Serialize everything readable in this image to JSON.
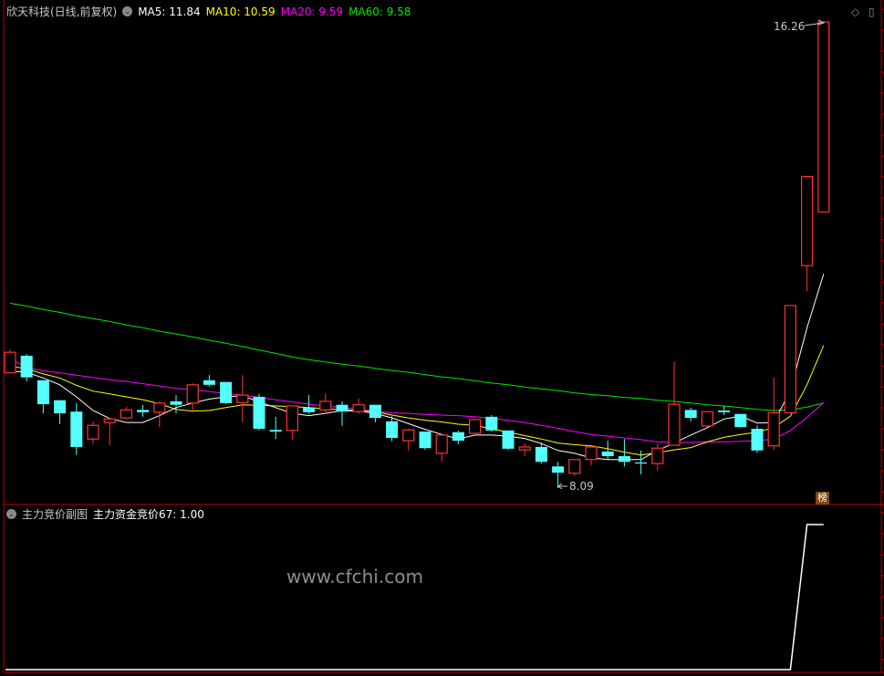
{
  "header": {
    "title": "欣天科技(日线,前复权)",
    "ma5": "MA5: 11.84",
    "ma10": "MA10: 10.59",
    "ma20": "MA20: 9.59",
    "ma60": "MA60: 9.58"
  },
  "sub_header": {
    "title": "主力竞价副图",
    "indicator": "主力资金竞价67: 1.00"
  },
  "badge": "榜",
  "watermark": "www.cfchi.com",
  "icons": [
    "chevron-down-icon",
    "diamond-icon",
    "panel-toggle-icon"
  ],
  "colors": {
    "up": "#ff3232",
    "down": "#54ffff",
    "ma5": "#ffffff",
    "ma10": "#ffff00",
    "ma20": "#ff00ff",
    "ma60": "#00e600",
    "divider": "#c00000"
  },
  "chart_data": [
    {
      "type": "candlestick",
      "high_label": "16.26",
      "low_label": "8.09",
      "ohlc": [
        [
          10.11,
          10.52,
          10.11,
          10.47
        ],
        [
          10.41,
          10.44,
          9.96,
          10.03
        ],
        [
          9.98,
          9.98,
          9.4,
          9.56
        ],
        [
          9.63,
          9.63,
          9.21,
          9.4
        ],
        [
          9.43,
          9.58,
          8.67,
          8.81
        ],
        [
          8.95,
          9.26,
          8.87,
          9.19
        ],
        [
          9.24,
          9.32,
          8.84,
          9.3
        ],
        [
          9.32,
          9.51,
          9.32,
          9.46
        ],
        [
          9.46,
          9.55,
          9.34,
          9.42
        ],
        [
          9.42,
          9.61,
          9.16,
          9.58
        ],
        [
          9.61,
          9.72,
          9.4,
          9.55
        ],
        [
          9.58,
          9.93,
          9.42,
          9.9
        ],
        [
          9.98,
          10.07,
          9.87,
          9.9
        ],
        [
          9.95,
          9.95,
          9.56,
          9.58
        ],
        [
          9.59,
          10.07,
          9.24,
          9.72
        ],
        [
          9.69,
          9.74,
          9.1,
          9.13
        ],
        [
          9.11,
          9.34,
          8.95,
          9.08
        ],
        [
          9.1,
          9.53,
          8.94,
          9.53
        ],
        [
          9.5,
          9.72,
          9.39,
          9.42
        ],
        [
          9.46,
          9.75,
          9.4,
          9.61
        ],
        [
          9.55,
          9.61,
          9.18,
          9.43
        ],
        [
          9.43,
          9.66,
          9.39,
          9.55
        ],
        [
          9.55,
          9.55,
          9.24,
          9.32
        ],
        [
          9.26,
          9.35,
          8.91,
          8.97
        ],
        [
          8.92,
          9.13,
          8.75,
          9.11
        ],
        [
          9.08,
          9.08,
          8.76,
          8.79
        ],
        [
          8.7,
          9.02,
          8.55,
          9.02
        ],
        [
          9.07,
          9.1,
          8.86,
          8.92
        ],
        [
          9.05,
          9.3,
          9.05,
          9.29
        ],
        [
          9.34,
          9.37,
          9.08,
          9.1
        ],
        [
          9.1,
          9.1,
          8.76,
          8.78
        ],
        [
          8.76,
          8.87,
          8.65,
          8.81
        ],
        [
          8.81,
          8.89,
          8.52,
          8.55
        ],
        [
          8.47,
          8.55,
          8.09,
          8.36
        ],
        [
          8.35,
          8.59,
          8.3,
          8.59
        ],
        [
          8.59,
          8.81,
          8.49,
          8.81
        ],
        [
          8.73,
          8.92,
          8.6,
          8.65
        ],
        [
          8.65,
          8.95,
          8.47,
          8.55
        ],
        [
          8.54,
          8.75,
          8.33,
          8.52
        ],
        [
          8.52,
          8.87,
          8.39,
          8.79
        ],
        [
          8.84,
          10.31,
          8.84,
          9.56
        ],
        [
          9.46,
          9.5,
          9.26,
          9.32
        ],
        [
          9.18,
          9.43,
          9.18,
          9.43
        ],
        [
          9.45,
          9.53,
          9.37,
          9.42
        ],
        [
          9.39,
          9.39,
          9.15,
          9.16
        ],
        [
          9.13,
          9.19,
          8.71,
          8.75
        ],
        [
          8.83,
          10.03,
          8.76,
          9.41
        ],
        [
          9.41,
          11.29,
          9.41,
          11.29
        ],
        [
          11.99,
          13.55,
          11.54,
          13.55
        ],
        [
          12.93,
          16.26,
          12.93,
          16.26
        ]
      ],
      "ma5": [
        10.14,
        10.12,
        10.02,
        9.9,
        9.69,
        9.45,
        9.31,
        9.24,
        9.24,
        9.36,
        9.5,
        9.58,
        9.65,
        9.69,
        9.71,
        9.6,
        9.5,
        9.4,
        9.36,
        9.4,
        9.45,
        9.44,
        9.4,
        9.32,
        9.22,
        9.12,
        9.03,
        8.95,
        9.02,
        9.02,
        9.0,
        8.96,
        8.87,
        8.75,
        8.7,
        8.62,
        8.59,
        8.59,
        8.59,
        8.75,
        8.88,
        9.02,
        9.15,
        9.3,
        9.35,
        9.23,
        9.24,
        9.8,
        10.9,
        11.84
      ],
      "ma10": [
        10.23,
        10.18,
        10.09,
        10.02,
        9.89,
        9.79,
        9.74,
        9.69,
        9.64,
        9.57,
        9.47,
        9.44,
        9.45,
        9.5,
        9.55,
        9.54,
        9.53,
        9.52,
        9.5,
        9.48,
        9.46,
        9.45,
        9.43,
        9.37,
        9.32,
        9.28,
        9.25,
        9.21,
        9.19,
        9.13,
        9.07,
        9.01,
        8.95,
        8.88,
        8.85,
        8.83,
        8.78,
        8.72,
        8.67,
        8.71,
        8.76,
        8.8,
        8.9,
        8.98,
        9.03,
        9.07,
        9.15,
        9.35,
        9.9,
        10.59
      ],
      "ma20": [
        10.36,
        10.2,
        10.15,
        10.11,
        10.07,
        10.03,
        9.99,
        9.96,
        9.92,
        9.88,
        9.84,
        9.81,
        9.78,
        9.75,
        9.72,
        9.68,
        9.64,
        9.6,
        9.56,
        9.53,
        9.5,
        9.47,
        9.44,
        9.41,
        9.4,
        9.38,
        9.37,
        9.36,
        9.34,
        9.31,
        9.28,
        9.24,
        9.19,
        9.14,
        9.08,
        9.03,
        9.0,
        8.97,
        8.94,
        8.9,
        8.89,
        8.89,
        8.9,
        8.9,
        8.91,
        8.92,
        8.95,
        9.1,
        9.33,
        9.59
      ],
      "ma60": [
        11.33,
        11.28,
        11.22,
        11.17,
        11.11,
        11.06,
        11.01,
        10.95,
        10.9,
        10.84,
        10.79,
        10.74,
        10.68,
        10.63,
        10.57,
        10.51,
        10.45,
        10.39,
        10.34,
        10.3,
        10.26,
        10.23,
        10.19,
        10.15,
        10.12,
        10.08,
        10.04,
        10.01,
        9.97,
        9.93,
        9.9,
        9.86,
        9.83,
        9.8,
        9.76,
        9.73,
        9.71,
        9.68,
        9.66,
        9.63,
        9.61,
        9.58,
        9.55,
        9.53,
        9.5,
        9.47,
        9.45,
        9.46,
        9.51,
        9.58
      ]
    },
    {
      "type": "line",
      "name": "主力资金竞价67",
      "values": [
        0,
        0,
        0,
        0,
        0,
        0,
        0,
        0,
        0,
        0,
        0,
        0,
        0,
        0,
        0,
        0,
        0,
        0,
        0,
        0,
        0,
        0,
        0,
        0,
        0,
        0,
        0,
        0,
        0,
        0,
        0,
        0,
        0,
        0,
        0,
        0,
        0,
        0,
        0,
        0,
        0,
        0,
        0,
        0,
        0,
        0,
        0,
        0,
        1,
        1
      ]
    }
  ]
}
